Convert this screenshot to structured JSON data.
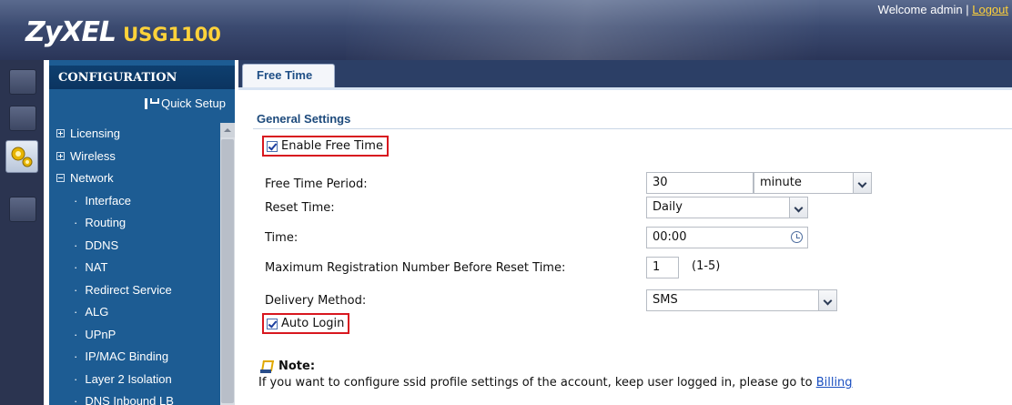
{
  "header": {
    "brand": "ZyXEL",
    "model": "USG1100",
    "welcome_text": "Welcome admin |",
    "logout_label": "Logout"
  },
  "icon_strip": {
    "items": [
      {
        "icon": "status-icon",
        "active": false
      },
      {
        "icon": "monitor-icon",
        "active": false
      },
      {
        "icon": "configuration-gears-icon",
        "active": true
      },
      {
        "icon": "maintenance-icon",
        "active": false
      }
    ]
  },
  "sidebar": {
    "title": "CONFIGURATION",
    "quick_setup": "Quick Setup",
    "items": [
      {
        "label": "Licensing",
        "level": "top",
        "expanded": false
      },
      {
        "label": "Wireless",
        "level": "top",
        "expanded": false
      },
      {
        "label": "Network",
        "level": "top",
        "expanded": true
      },
      {
        "label": "Interface",
        "level": "sub"
      },
      {
        "label": "Routing",
        "level": "sub"
      },
      {
        "label": "DDNS",
        "level": "sub"
      },
      {
        "label": "NAT",
        "level": "sub"
      },
      {
        "label": "Redirect Service",
        "level": "sub"
      },
      {
        "label": "ALG",
        "level": "sub"
      },
      {
        "label": "UPnP",
        "level": "sub"
      },
      {
        "label": "IP/MAC Binding",
        "level": "sub"
      },
      {
        "label": "Layer 2 Isolation",
        "level": "sub"
      },
      {
        "label": "DNS Inbound LB",
        "level": "sub"
      }
    ]
  },
  "tabs": [
    {
      "label": "Free Time",
      "active": true
    }
  ],
  "general_settings": {
    "title": "General Settings",
    "enable_free_time": {
      "label": "Enable Free Time",
      "checked": true
    },
    "free_time_period": {
      "label": "Free Time Period:",
      "value": "30",
      "unit": "minute"
    },
    "reset_time": {
      "label": "Reset Time:",
      "value": "Daily"
    },
    "time": {
      "label": "Time:",
      "value": "00:00"
    },
    "max_registration": {
      "label": "Maximum Registration Number Before Reset Time:",
      "value": "1",
      "hint": "(1-5)"
    },
    "delivery_method": {
      "label": "Delivery Method:",
      "value": "SMS"
    },
    "auto_login": {
      "label": "Auto Login",
      "checked": true
    }
  },
  "note": {
    "title": "Note:",
    "text": "If you want to configure ssid profile settings of the account, keep user logged in, please go to",
    "link": "Billing"
  },
  "colors": {
    "header": "#3b4a70",
    "sidebar": "#1d5c93",
    "highlight_border": "#d8171f",
    "logo_model": "#ffd23a"
  }
}
